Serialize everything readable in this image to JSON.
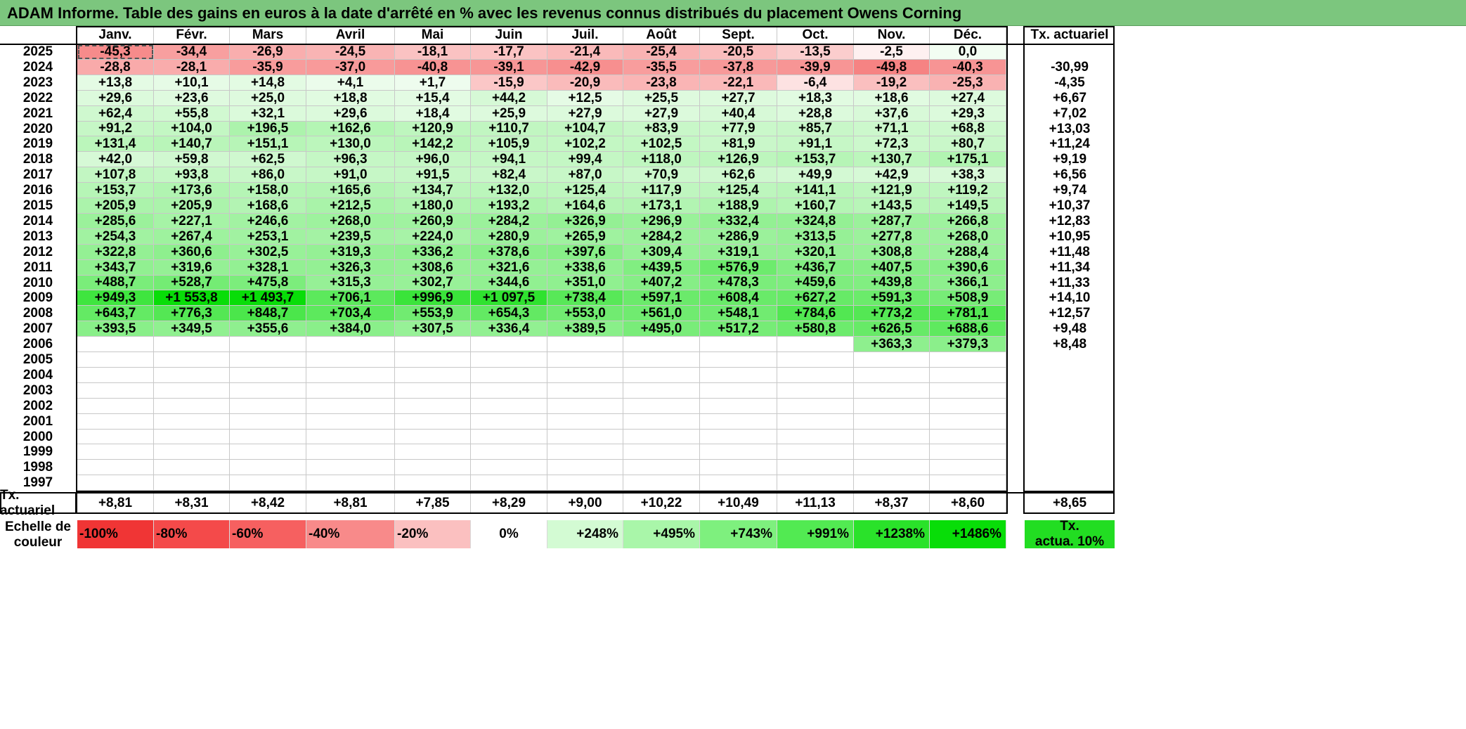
{
  "title": "ADAM Informe. Table des gains en euros à la date d'arrêté en % avec les revenus connus distribués du placement Owens Corning",
  "months": [
    "Janv.",
    "Févr.",
    "Mars",
    "Avril",
    "Mai",
    "Juin",
    "Juil.",
    "Août",
    "Sept.",
    "Oct.",
    "Nov.",
    "Déc."
  ],
  "tx_header": "Tx. actuariel",
  "rows": [
    {
      "year": "2025",
      "values": [
        "-45,3",
        "-34,4",
        "-26,9",
        "-24,5",
        "-18,1",
        "-17,7",
        "-21,4",
        "-25,4",
        "-20,5",
        "-13,5",
        "-2,5",
        "0,0"
      ],
      "tx": ""
    },
    {
      "year": "2024",
      "values": [
        "-28,8",
        "-28,1",
        "-35,9",
        "-37,0",
        "-40,8",
        "-39,1",
        "-42,9",
        "-35,5",
        "-37,8",
        "-39,9",
        "-49,8",
        "-40,3"
      ],
      "tx": "-30,99"
    },
    {
      "year": "2023",
      "values": [
        "+13,8",
        "+10,1",
        "+14,8",
        "+4,1",
        "+1,7",
        "-15,9",
        "-20,9",
        "-23,8",
        "-22,1",
        "-6,4",
        "-19,2",
        "-25,3"
      ],
      "tx": "-4,35"
    },
    {
      "year": "2022",
      "values": [
        "+29,6",
        "+23,6",
        "+25,0",
        "+18,8",
        "+15,4",
        "+44,2",
        "+12,5",
        "+25,5",
        "+27,7",
        "+18,3",
        "+18,6",
        "+27,4"
      ],
      "tx": "+6,67"
    },
    {
      "year": "2021",
      "values": [
        "+62,4",
        "+55,8",
        "+32,1",
        "+29,6",
        "+18,4",
        "+25,9",
        "+27,9",
        "+27,9",
        "+40,4",
        "+28,8",
        "+37,6",
        "+29,3"
      ],
      "tx": "+7,02"
    },
    {
      "year": "2020",
      "values": [
        "+91,2",
        "+104,0",
        "+196,5",
        "+162,6",
        "+120,9",
        "+110,7",
        "+104,7",
        "+83,9",
        "+77,9",
        "+85,7",
        "+71,1",
        "+68,8"
      ],
      "tx": "+13,03"
    },
    {
      "year": "2019",
      "values": [
        "+131,4",
        "+140,7",
        "+151,1",
        "+130,0",
        "+142,2",
        "+105,9",
        "+102,2",
        "+102,5",
        "+81,9",
        "+91,1",
        "+72,3",
        "+80,7"
      ],
      "tx": "+11,24"
    },
    {
      "year": "2018",
      "values": [
        "+42,0",
        "+59,8",
        "+62,5",
        "+96,3",
        "+96,0",
        "+94,1",
        "+99,4",
        "+118,0",
        "+126,9",
        "+153,7",
        "+130,7",
        "+175,1"
      ],
      "tx": "+9,19"
    },
    {
      "year": "2017",
      "values": [
        "+107,8",
        "+93,8",
        "+86,0",
        "+91,0",
        "+91,5",
        "+82,4",
        "+87,0",
        "+70,9",
        "+62,6",
        "+49,9",
        "+42,9",
        "+38,3"
      ],
      "tx": "+6,56"
    },
    {
      "year": "2016",
      "values": [
        "+153,7",
        "+173,6",
        "+158,0",
        "+165,6",
        "+134,7",
        "+132,0",
        "+125,4",
        "+117,9",
        "+125,4",
        "+141,1",
        "+121,9",
        "+119,2"
      ],
      "tx": "+9,74"
    },
    {
      "year": "2015",
      "values": [
        "+205,9",
        "+205,9",
        "+168,6",
        "+212,5",
        "+180,0",
        "+193,2",
        "+164,6",
        "+173,1",
        "+188,9",
        "+160,7",
        "+143,5",
        "+149,5"
      ],
      "tx": "+10,37"
    },
    {
      "year": "2014",
      "values": [
        "+285,6",
        "+227,1",
        "+246,6",
        "+268,0",
        "+260,9",
        "+284,2",
        "+326,9",
        "+296,9",
        "+332,4",
        "+324,8",
        "+287,7",
        "+266,8"
      ],
      "tx": "+12,83"
    },
    {
      "year": "2013",
      "values": [
        "+254,3",
        "+267,4",
        "+253,1",
        "+239,5",
        "+224,0",
        "+280,9",
        "+265,9",
        "+284,2",
        "+286,9",
        "+313,5",
        "+277,8",
        "+268,0"
      ],
      "tx": "+10,95"
    },
    {
      "year": "2012",
      "values": [
        "+322,8",
        "+360,6",
        "+302,5",
        "+319,3",
        "+336,2",
        "+378,6",
        "+397,6",
        "+309,4",
        "+319,1",
        "+320,1",
        "+308,8",
        "+288,4"
      ],
      "tx": "+11,48"
    },
    {
      "year": "2011",
      "values": [
        "+343,7",
        "+319,6",
        "+328,1",
        "+326,3",
        "+308,6",
        "+321,6",
        "+338,6",
        "+439,5",
        "+576,9",
        "+436,7",
        "+407,5",
        "+390,6"
      ],
      "tx": "+11,34"
    },
    {
      "year": "2010",
      "values": [
        "+488,7",
        "+528,7",
        "+475,8",
        "+315,3",
        "+302,7",
        "+344,6",
        "+351,0",
        "+407,2",
        "+478,3",
        "+459,6",
        "+439,8",
        "+366,1"
      ],
      "tx": "+11,33"
    },
    {
      "year": "2009",
      "values": [
        "+949,3",
        "+1 553,8",
        "+1 493,7",
        "+706,1",
        "+996,9",
        "+1 097,5",
        "+738,4",
        "+597,1",
        "+608,4",
        "+627,2",
        "+591,3",
        "+508,9"
      ],
      "tx": "+14,10"
    },
    {
      "year": "2008",
      "values": [
        "+643,7",
        "+776,3",
        "+848,7",
        "+703,4",
        "+553,9",
        "+654,3",
        "+553,0",
        "+561,0",
        "+548,1",
        "+784,6",
        "+773,2",
        "+781,1"
      ],
      "tx": "+12,57"
    },
    {
      "year": "2007",
      "values": [
        "+393,5",
        "+349,5",
        "+355,6",
        "+384,0",
        "+307,5",
        "+336,4",
        "+389,5",
        "+495,0",
        "+517,2",
        "+580,8",
        "+626,5",
        "+688,6"
      ],
      "tx": "+9,48"
    },
    {
      "year": "2006",
      "values": [
        "",
        "",
        "",
        "",
        "",
        "",
        "",
        "",
        "",
        "",
        "+363,3",
        "+379,3"
      ],
      "tx": "+8,48"
    },
    {
      "year": "2005",
      "values": [
        "",
        "",
        "",
        "",
        "",
        "",
        "",
        "",
        "",
        "",
        "",
        ""
      ],
      "tx": ""
    },
    {
      "year": "2004",
      "values": [
        "",
        "",
        "",
        "",
        "",
        "",
        "",
        "",
        "",
        "",
        "",
        ""
      ],
      "tx": ""
    },
    {
      "year": "2003",
      "values": [
        "",
        "",
        "",
        "",
        "",
        "",
        "",
        "",
        "",
        "",
        "",
        ""
      ],
      "tx": ""
    },
    {
      "year": "2002",
      "values": [
        "",
        "",
        "",
        "",
        "",
        "",
        "",
        "",
        "",
        "",
        "",
        ""
      ],
      "tx": ""
    },
    {
      "year": "2001",
      "values": [
        "",
        "",
        "",
        "",
        "",
        "",
        "",
        "",
        "",
        "",
        "",
        ""
      ],
      "tx": ""
    },
    {
      "year": "2000",
      "values": [
        "",
        "",
        "",
        "",
        "",
        "",
        "",
        "",
        "",
        "",
        "",
        ""
      ],
      "tx": ""
    },
    {
      "year": "1999",
      "values": [
        "",
        "",
        "",
        "",
        "",
        "",
        "",
        "",
        "",
        "",
        "",
        ""
      ],
      "tx": ""
    },
    {
      "year": "1998",
      "values": [
        "",
        "",
        "",
        "",
        "",
        "",
        "",
        "",
        "",
        "",
        "",
        ""
      ],
      "tx": ""
    },
    {
      "year": "1997",
      "values": [
        "",
        "",
        "",
        "",
        "",
        "",
        "",
        "",
        "",
        "",
        "",
        ""
      ],
      "tx": ""
    }
  ],
  "footer": {
    "label": "Tx. actuariel",
    "values": [
      "+8,81",
      "+8,31",
      "+8,42",
      "+8,81",
      "+7,85",
      "+8,29",
      "+9,00",
      "+10,22",
      "+10,49",
      "+11,13",
      "+8,37",
      "+8,60"
    ],
    "tx": "+8,65"
  },
  "scale": {
    "label_line1": "Echelle de",
    "label_line2": "couleur",
    "items": [
      {
        "text": "-100%",
        "color": "#f03535"
      },
      {
        "text": "-80%",
        "color": "#f44a4a"
      },
      {
        "text": "-60%",
        "color": "#f66060"
      },
      {
        "text": "-40%",
        "color": "#f88a8a"
      },
      {
        "text": "-20%",
        "color": "#fbc0c0"
      },
      {
        "text": "0%",
        "color": "#ffffff"
      },
      {
        "text": "+248%",
        "color": "#d3fbd3"
      },
      {
        "text": "+495%",
        "color": "#a9f6a9"
      },
      {
        "text": "+743%",
        "color": "#7ef07e"
      },
      {
        "text": "+991%",
        "color": "#52ea52"
      },
      {
        "text": "+1238%",
        "color": "#2ae22a"
      },
      {
        "text": "+1486%",
        "color": "#08dd08"
      }
    ],
    "tx_line1": "Tx.",
    "tx_line2": "actua. 10%",
    "tx_color": "#22dd22"
  },
  "colors": {
    "title_bar": "#7cc67e",
    "negative_max": "#f03535",
    "positive_max": "#08dd08",
    "neutral": "#ffffff"
  }
}
